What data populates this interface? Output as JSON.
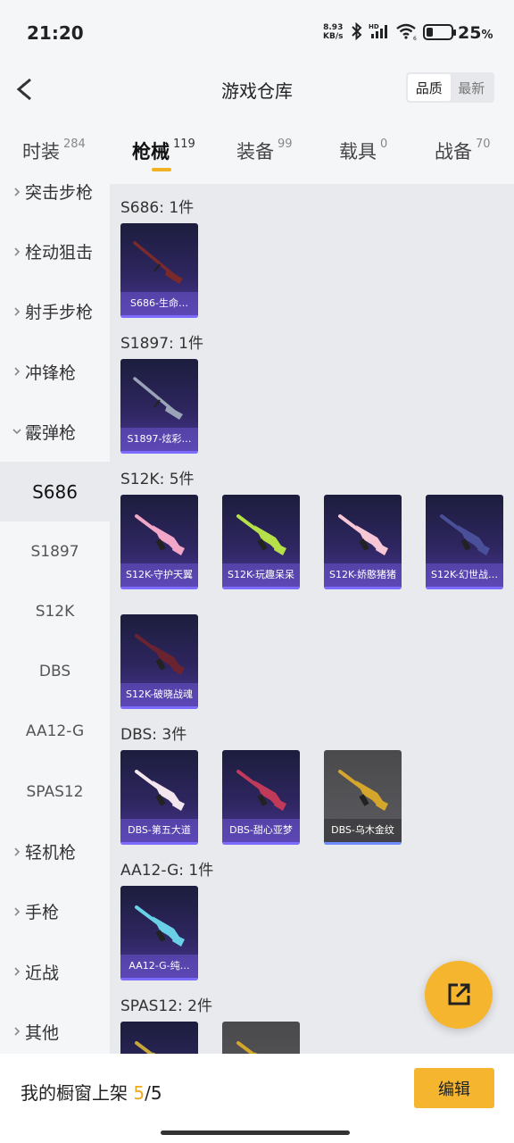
{
  "status_bar": {
    "time": "21:20",
    "net_speed_value": "8.93",
    "net_speed_unit": "KB/s",
    "battery_percent": "25",
    "battery_suffix": "%",
    "icons": [
      "bluetooth-icon",
      "hd-signal-icon",
      "wifi-icon",
      "battery-icon"
    ]
  },
  "header": {
    "title": "游戏仓库",
    "back_icon": "chevron-left-icon",
    "sort_options": [
      "品质",
      "最新"
    ],
    "sort_selected": "品质"
  },
  "tabs": [
    {
      "label": "时装",
      "count": "284"
    },
    {
      "label": "枪械",
      "count": "119",
      "active": true
    },
    {
      "label": "装备",
      "count": "99"
    },
    {
      "label": "载具",
      "count": "0"
    },
    {
      "label": "战备",
      "count": "70"
    }
  ],
  "sidebar": {
    "items": [
      {
        "label": "突击步枪",
        "type": "category",
        "expanded": false
      },
      {
        "label": "栓动狙击",
        "type": "category",
        "expanded": false
      },
      {
        "label": "射手步枪",
        "type": "category",
        "expanded": false
      },
      {
        "label": "冲锋枪",
        "type": "category",
        "expanded": false
      },
      {
        "label": "霰弹枪",
        "type": "category",
        "expanded": true
      },
      {
        "label": "S686",
        "type": "sub",
        "selected": true
      },
      {
        "label": "S1897",
        "type": "sub"
      },
      {
        "label": "S12K",
        "type": "sub"
      },
      {
        "label": "DBS",
        "type": "sub"
      },
      {
        "label": "AA12-G",
        "type": "sub"
      },
      {
        "label": "SPAS12",
        "type": "sub"
      },
      {
        "label": "轻机枪",
        "type": "category",
        "expanded": false
      },
      {
        "label": "手枪",
        "type": "category",
        "expanded": false
      },
      {
        "label": "近战",
        "type": "category",
        "expanded": false
      },
      {
        "label": "其他",
        "type": "category",
        "expanded": false
      }
    ]
  },
  "sections": [
    {
      "title": "S686: 1件",
      "items": [
        {
          "name": "S686-生命…",
          "rarity": "purple"
        }
      ]
    },
    {
      "title": "S1897: 1件",
      "items": [
        {
          "name": "S1897-炫彩…",
          "rarity": "purple"
        }
      ]
    },
    {
      "title": "S12K: 5件",
      "items": [
        {
          "name": "S12K-守护天翼",
          "rarity": "purple"
        },
        {
          "name": "S12K-玩趣呆呆",
          "rarity": "purple"
        },
        {
          "name": "S12K-娇憨猪猪",
          "rarity": "purple"
        },
        {
          "name": "S12K-幻世战…",
          "rarity": "purple"
        },
        {
          "name": "S12K-破晓战魂",
          "rarity": "purple"
        }
      ]
    },
    {
      "title": "DBS: 3件",
      "items": [
        {
          "name": "DBS-第五大道",
          "rarity": "purple"
        },
        {
          "name": "DBS-甜心亚梦",
          "rarity": "purple"
        },
        {
          "name": "DBS-乌木金纹",
          "rarity": "grey"
        }
      ]
    },
    {
      "title": "AA12-G: 1件",
      "items": [
        {
          "name": "AA12-G-纯…",
          "rarity": "purple"
        }
      ]
    },
    {
      "title": "SPAS12: 2件",
      "items": [
        {
          "name": "",
          "rarity": "purple"
        },
        {
          "name": "",
          "rarity": "grey"
        }
      ]
    }
  ],
  "share_button_icon": "share-external-icon",
  "bottom": {
    "shelf_label": "我的橱窗上架 ",
    "shelf_count": "5",
    "shelf_sep": "/",
    "shelf_total": "5",
    "edit_label": "编辑"
  },
  "colors": {
    "accent": "#f5b52f",
    "card_purple": "#2e2660",
    "card_grey": "#5c5c60"
  }
}
